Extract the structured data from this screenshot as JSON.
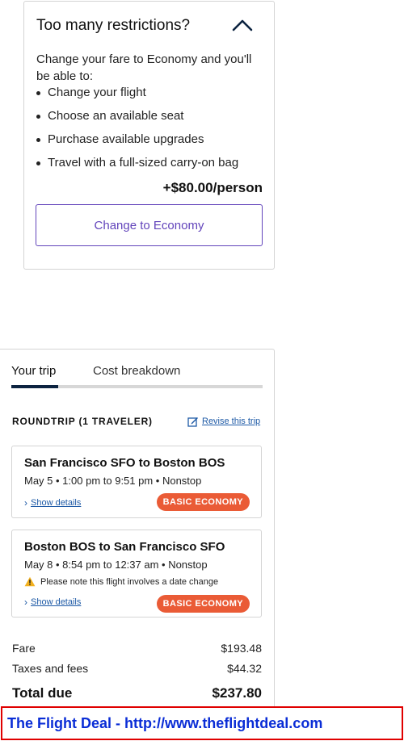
{
  "upsell": {
    "title": "Too many restrictions?",
    "intro": "Change your fare to Economy and you'll be able to:",
    "benefits": [
      "Change your flight",
      "Choose an available seat",
      "Purchase available upgrades",
      "Travel with a full-sized carry-on bag"
    ],
    "price": "+$80.00/person",
    "button_label": "Change to Economy"
  },
  "tabs": [
    "Your trip",
    "Cost breakdown"
  ],
  "trip": {
    "roundtrip_label": "ROUNDTRIP (1 TRAVELER)",
    "revise_label": "Revise this trip",
    "flights": [
      {
        "route": "San Francisco SFO to Boston BOS",
        "times": "May 5 • 1:00 pm to 9:51 pm • Nonstop",
        "details_label": "Show details",
        "badge": "BASIC ECONOMY"
      },
      {
        "route": "Boston BOS to San Francisco SFO",
        "times": "May 8 • 8:54 pm to 12:37 am • Nonstop",
        "warning": "Please note this flight involves a date change",
        "details_label": "Show details",
        "badge": "BASIC ECONOMY"
      }
    ]
  },
  "costs": {
    "fare_label": "Fare",
    "fare_value": "$193.48",
    "taxes_label": "Taxes and fees",
    "taxes_value": "$44.32",
    "total_label": "Total due",
    "total_value": "$237.80"
  },
  "banner": {
    "text": "The Flight Deal - http://www.theflightdeal.com"
  },
  "colors": {
    "accent_purple": "#6244bb",
    "badge_orange": "#ea5b36",
    "link_blue": "#1e5aa6",
    "tab_indicator": "#0c2340",
    "banner_border": "#e00000",
    "banner_text": "#0a2dd6"
  }
}
